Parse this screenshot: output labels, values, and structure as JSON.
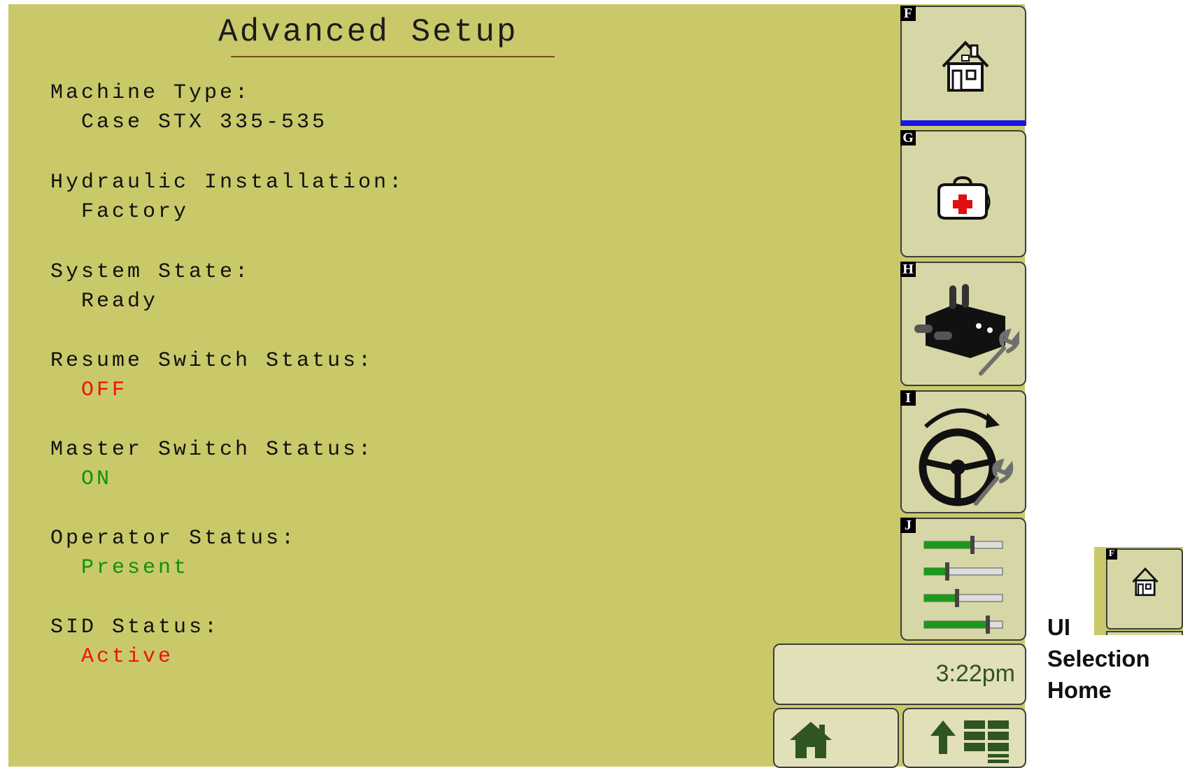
{
  "screen": {
    "title": "Advanced Setup",
    "fields": [
      {
        "label": "Machine Type:",
        "value": "Case STX 335-535",
        "value_color": "#111111"
      },
      {
        "label": "Hydraulic Installation:",
        "value": "Factory",
        "value_color": "#111111"
      },
      {
        "label": "System State:",
        "value": "Ready",
        "value_color": "#111111"
      },
      {
        "label": "Resume Switch Status:",
        "value": "OFF",
        "value_color": "#f01010"
      },
      {
        "label": "Master Switch Status:",
        "value": "ON",
        "value_color": "#109010"
      },
      {
        "label": "Operator Status:",
        "value": "Present",
        "value_color": "#109010"
      },
      {
        "label": "SID Status:",
        "value": "Active",
        "value_color": "#f01010"
      }
    ]
  },
  "side_buttons": [
    {
      "key": "F",
      "icon": "home-icon",
      "selected": true
    },
    {
      "key": "G",
      "icon": "first-aid-kit-icon",
      "selected": false
    },
    {
      "key": "H",
      "icon": "hydraulic-valve-wrench-icon",
      "selected": false
    },
    {
      "key": "I",
      "icon": "steering-wheel-wrench-icon",
      "selected": false
    },
    {
      "key": "J",
      "icon": "sliders-icon",
      "selected": false
    }
  ],
  "clock": "3:22pm",
  "bottom_buttons": [
    {
      "icon": "home-icon"
    },
    {
      "icon": "menu-up-icon"
    }
  ],
  "legend": {
    "line1": "UI",
    "line2": "Selection",
    "line3": "Home",
    "thumb_key": "F"
  },
  "colors": {
    "background": "#c9c96a",
    "button_face": "#d7d6a7",
    "selection": "#1515ee",
    "icon_green": "#2e5522"
  }
}
